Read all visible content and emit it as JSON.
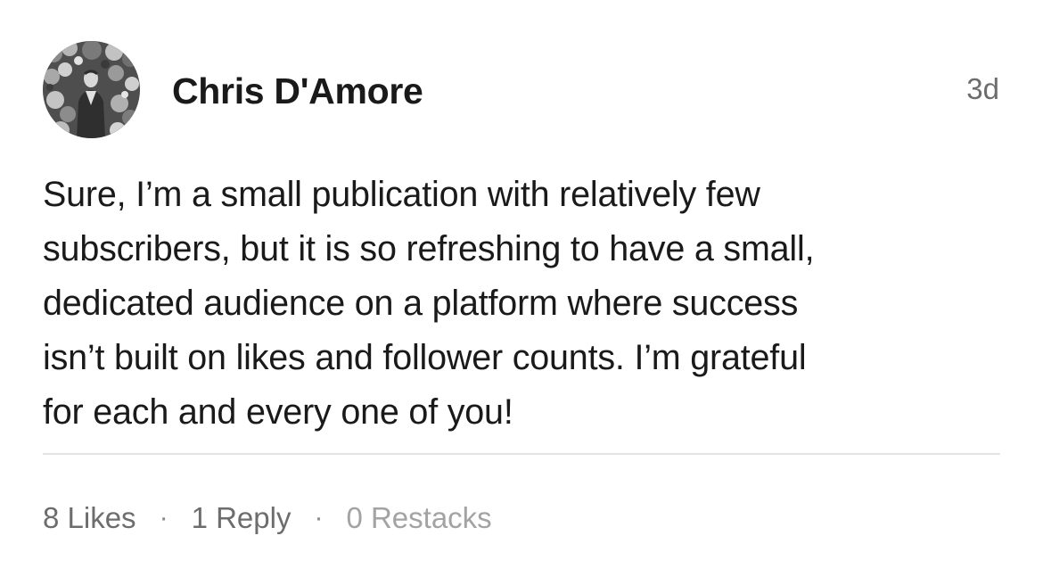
{
  "note": {
    "author": {
      "name": "Chris D'Amore",
      "avatar_icon": "profile-photo"
    },
    "timestamp": "3d",
    "body": "Sure, I’m a small publication with relatively few\nsubscribers, but it is so refreshing to have a small,\ndedicated audience on a platform where success\nisn’t built on likes and follower counts. I’m grateful\nfor each and every one of you!",
    "stats": {
      "likes": "8 Likes",
      "replies": "1 Reply",
      "restacks": "0 Restacks",
      "separator": "·"
    }
  },
  "colors": {
    "text_primary": "#1a1a1a",
    "text_secondary": "#6d6d6d",
    "text_muted": "#a3a3a3",
    "divider": "#e4e4e4",
    "background": "#ffffff"
  }
}
